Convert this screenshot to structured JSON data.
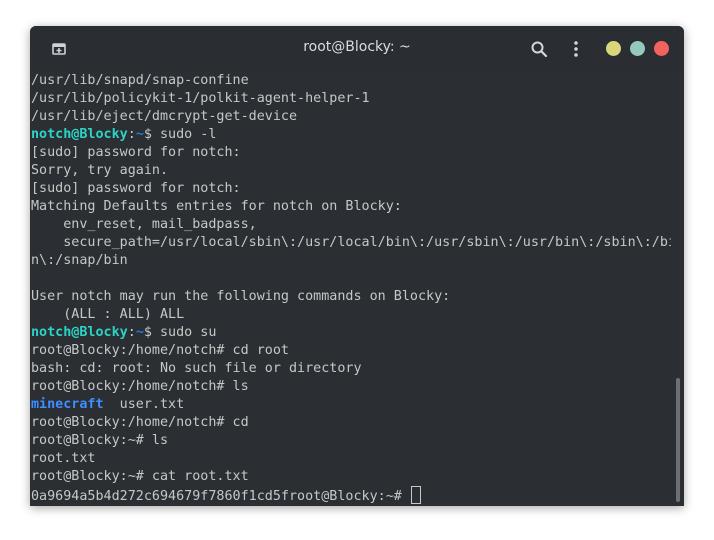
{
  "window": {
    "title": "root@Blocky: ~"
  },
  "colors": {
    "min_dot": "#d9d77a",
    "max_dot": "#93c9bf",
    "close_dot": "#f2625e",
    "user_prompt": "#2bd4c5",
    "dir_listing": "#3d8fff"
  },
  "icons": {
    "new_tab": "new-tab-icon",
    "search": "search-icon",
    "menu": "kebab-menu-icon"
  },
  "terminal": {
    "lines": [
      {
        "t": "plain",
        "text": "/usr/lib/snapd/snap-confine"
      },
      {
        "t": "plain",
        "text": "/usr/lib/policykit-1/polkit-agent-helper-1"
      },
      {
        "t": "plain",
        "text": "/usr/lib/eject/dmcrypt-get-device"
      },
      {
        "t": "prompt",
        "user": "notch@Blocky",
        "path": "~",
        "sym": "$ ",
        "cmd": "sudo -l"
      },
      {
        "t": "plain",
        "text": "[sudo] password for notch:"
      },
      {
        "t": "plain",
        "text": "Sorry, try again."
      },
      {
        "t": "plain",
        "text": "[sudo] password for notch:"
      },
      {
        "t": "plain",
        "text": "Matching Defaults entries for notch on Blocky:"
      },
      {
        "t": "plain",
        "text": "    env_reset, mail_badpass,"
      },
      {
        "t": "plain",
        "text": "    secure_path=/usr/local/sbin\\:/usr/local/bin\\:/usr/sbin\\:/usr/bin\\:/sbin\\:/bi"
      },
      {
        "t": "plain",
        "text": "n\\:/snap/bin"
      },
      {
        "t": "plain",
        "text": ""
      },
      {
        "t": "plain",
        "text": "User notch may run the following commands on Blocky:"
      },
      {
        "t": "plain",
        "text": "    (ALL : ALL) ALL"
      },
      {
        "t": "prompt",
        "user": "notch@Blocky",
        "path": "~",
        "sym": "$ ",
        "cmd": "sudo su"
      },
      {
        "t": "plain",
        "text": "root@Blocky:/home/notch# cd root"
      },
      {
        "t": "plain",
        "text": "bash: cd: root: No such file or directory"
      },
      {
        "t": "plain",
        "text": "root@Blocky:/home/notch# ls"
      },
      {
        "t": "ls",
        "dir": "minecraft",
        "rest": "  user.txt"
      },
      {
        "t": "plain",
        "text": "root@Blocky:/home/notch# cd"
      },
      {
        "t": "plain",
        "text": "root@Blocky:~# ls"
      },
      {
        "t": "plain",
        "text": "root.txt"
      },
      {
        "t": "plain",
        "text": "root@Blocky:~# cat root.txt"
      },
      {
        "t": "current",
        "text": "0a9694a5b4d272c694679f7860f1cd5froot@Blocky:~# "
      }
    ]
  }
}
